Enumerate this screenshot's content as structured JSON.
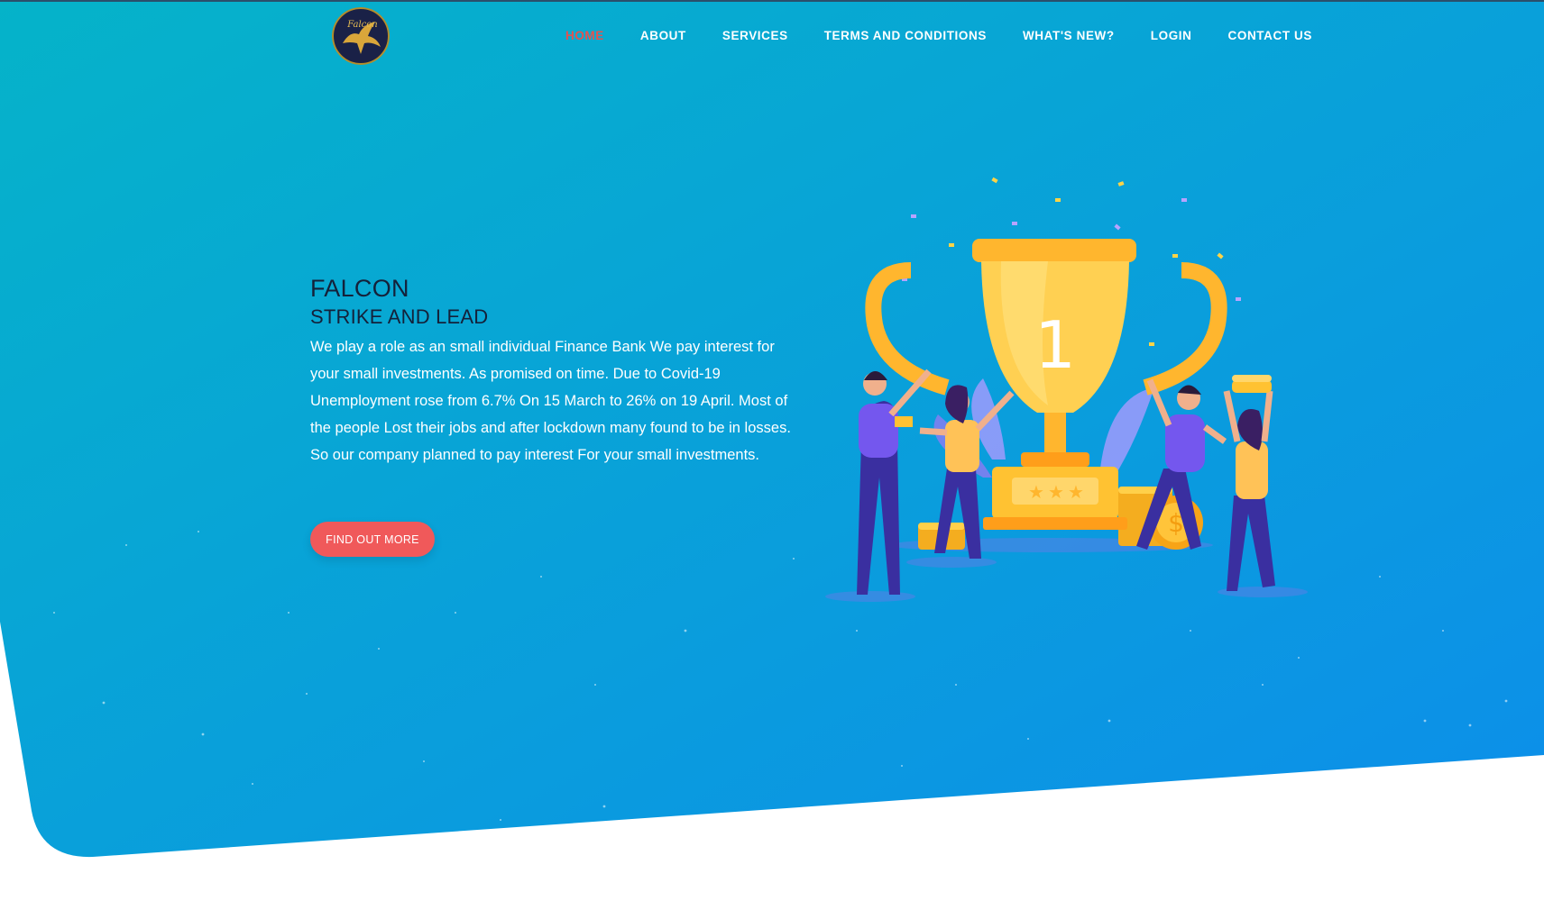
{
  "brand": {
    "logo_text": "Falcon",
    "logo_icon": "eagle-emblem"
  },
  "nav": {
    "items": [
      {
        "label": "HOME",
        "active": true
      },
      {
        "label": "ABOUT",
        "active": false
      },
      {
        "label": "SERVICES",
        "active": false
      },
      {
        "label": "TERMS AND CONDITIONS",
        "active": false
      },
      {
        "label": "WHAT'S NEW?",
        "active": false
      },
      {
        "label": "LOGIN",
        "active": false
      },
      {
        "label": "CONTACT US",
        "active": false
      }
    ]
  },
  "hero": {
    "title": "FALCON",
    "subtitle": "STRIKE AND LEAD",
    "description": "We play a role as an small individual Finance Bank We pay interest for your small investments. As promised on time. Due to Covid-19 Unemployment rose from 6.7% On 15 March to 26% on 19 April. Most of the people Lost their jobs and after lockdown many found to be in losses. So our company planned to pay interest For your small investments.",
    "cta_label": "FIND OUT MORE"
  },
  "illustration": {
    "trophy_number": "1",
    "icons": [
      "trophy-icon",
      "coin-stack-icon",
      "dollar-coin-icon",
      "confetti",
      "celebrating-people"
    ]
  },
  "colors": {
    "gradient_start": "#05b3c9",
    "gradient_end": "#0d8eea",
    "accent": "#f0595a",
    "nav_active": "#e4524f",
    "heading": "#14213a",
    "trophy_gold": "#ffb62e"
  }
}
